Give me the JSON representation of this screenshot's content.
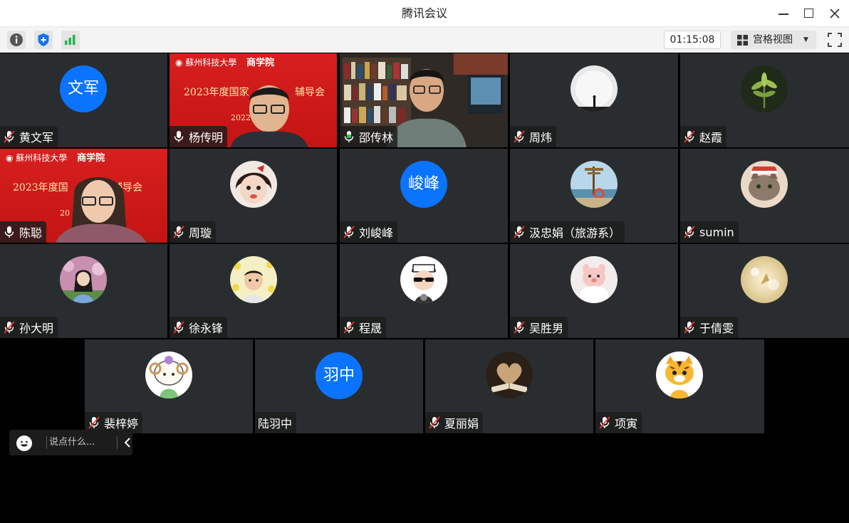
{
  "window": {
    "title": "腾讯会议"
  },
  "toolbar": {
    "icons": [
      "info-icon",
      "shield-icon",
      "signal-icon"
    ],
    "timer": "01:15:08",
    "view_label": "宫格视图"
  },
  "chat": {
    "placeholder": "说点什么..."
  },
  "colors": {
    "accent_blue": "#0a74ff",
    "tile_bg": "#2a2d30",
    "active_border": "#2fbf5f",
    "banner_red": "#d71f1f"
  },
  "participants": [
    {
      "name": "黄文军",
      "avatar_text": "文军",
      "mic": "muted"
    },
    {
      "name": "杨传明",
      "video": true,
      "mic": "on",
      "banner_line1": "商学院",
      "banner_line2": "2023年度国家",
      "banner_line3": "辅导会",
      "banner_year": "2022"
    },
    {
      "name": "邵传林",
      "video": true,
      "mic": "on",
      "speaking": true
    },
    {
      "name": "周炜",
      "mic": "muted"
    },
    {
      "name": "赵霞",
      "mic": "muted"
    },
    {
      "name": "陈聪",
      "video": true,
      "mic": "on",
      "banner_line1": "商学院",
      "banner_line2": "2023年度国",
      "banner_line3": "辅导会",
      "banner_year": "20"
    },
    {
      "name": "周璇",
      "mic": "muted"
    },
    {
      "name": "刘峻峰",
      "avatar_text": "峻峰",
      "mic": "muted"
    },
    {
      "name": "汲忠娟（旅游系）",
      "mic": "muted"
    },
    {
      "name": "sumin",
      "mic": "muted"
    },
    {
      "name": "孙大明",
      "mic": "muted"
    },
    {
      "name": "徐永锋",
      "mic": "muted"
    },
    {
      "name": "程晟",
      "mic": "muted"
    },
    {
      "name": "吴胜男",
      "mic": "muted"
    },
    {
      "name": "于倩雯",
      "mic": "muted"
    },
    {
      "name": "裴梓婷",
      "mic": "muted"
    },
    {
      "name": "陆羽中",
      "avatar_text": "羽中",
      "mic": "none"
    },
    {
      "name": "夏丽娟",
      "mic": "muted"
    },
    {
      "name": "项寅",
      "mic": "muted"
    }
  ]
}
